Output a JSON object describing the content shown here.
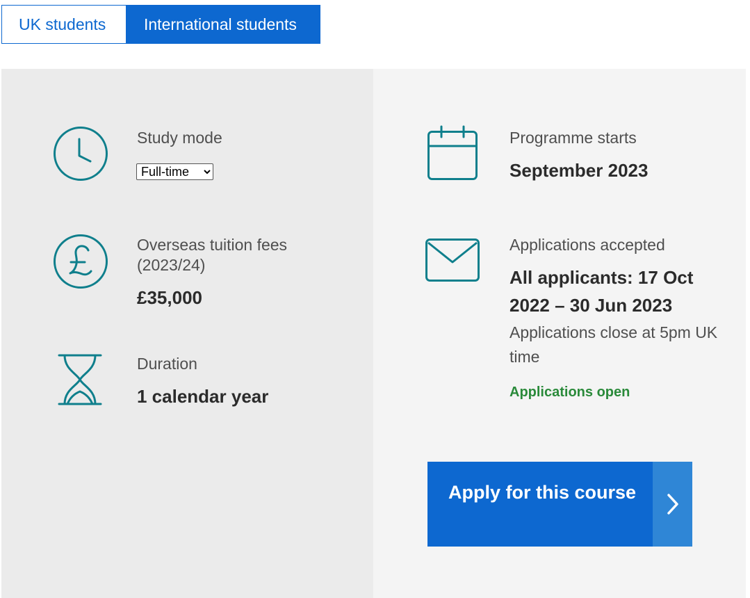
{
  "tabs": {
    "uk": "UK students",
    "international": "International students",
    "active": "international"
  },
  "left": {
    "study_mode": {
      "label": "Study mode",
      "selected": "Full-time",
      "icon": "clock-icon"
    },
    "fees": {
      "label": "Overseas tuition fees (2023/24)",
      "value": "£35,000",
      "icon": "pound-icon"
    },
    "duration": {
      "label": "Duration",
      "value": "1 calendar year",
      "icon": "hourglass-icon"
    }
  },
  "right": {
    "start": {
      "label": "Programme starts",
      "value": "September 2023",
      "icon": "calendar-icon"
    },
    "applications": {
      "label": "Applications accepted",
      "value": "All applicants: 17 Oct 2022 – 30 Jun 2023",
      "note": "Applications close at 5pm UK time",
      "status": "Applications open",
      "icon": "envelope-icon"
    }
  },
  "apply": {
    "label": "Apply for this course",
    "icon": "chevron-right-icon"
  },
  "colors": {
    "brand_blue": "#0d68d0",
    "icon_teal": "#0f7f8c",
    "status_green": "#2a8a3a"
  }
}
